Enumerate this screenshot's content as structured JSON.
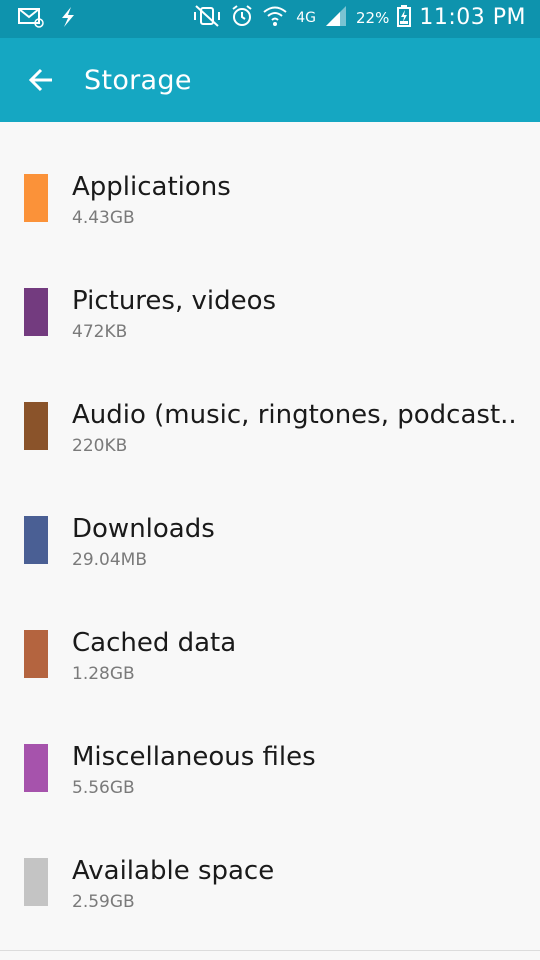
{
  "status_bar": {
    "left_icons": [
      "email-notification-icon",
      "flash-icon"
    ],
    "right_icons": [
      "mute-vibrate-icon",
      "alarm-icon",
      "wifi-icon",
      "lte-signal-icon"
    ],
    "network_label": "4G",
    "battery": "22%",
    "time": "11:03 PM"
  },
  "header": {
    "title": "Storage",
    "color": "#15a7c2"
  },
  "items": [
    {
      "label": "Applications",
      "size": "4.43GB",
      "color": "#fb9239"
    },
    {
      "label": "Pictures, videos",
      "size": "472KB",
      "color": "#733b7f"
    },
    {
      "label": "Audio (music, ringtones, podcast..",
      "size": "220KB",
      "color": "#8a532a"
    },
    {
      "label": "Downloads",
      "size": "29.04MB",
      "color": "#4a5f94"
    },
    {
      "label": "Cached data",
      "size": "1.28GB",
      "color": "#b4643f"
    },
    {
      "label": "Miscellaneous files",
      "size": "5.56GB",
      "color": "#a653ac"
    },
    {
      "label": "Available space",
      "size": "2.59GB",
      "color": "#c4c4c4"
    }
  ]
}
